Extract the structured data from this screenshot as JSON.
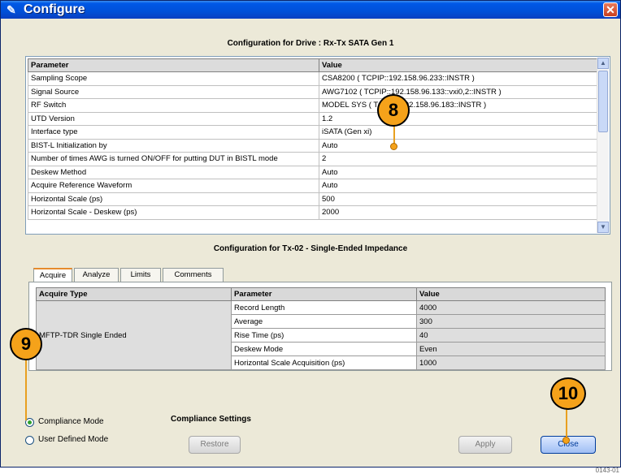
{
  "window": {
    "title": "Configure",
    "close_glyph": "✕",
    "icon": "wrench-icon"
  },
  "drive_section": {
    "title": "Configuration for Drive : Rx-Tx SATA Gen 1",
    "columns": [
      "Parameter",
      "Value"
    ],
    "rows": [
      [
        "Sampling Scope",
        "CSA8200 ( TCPIP::192.158.96.233::INSTR )"
      ],
      [
        "Signal Source",
        "AWG7102 ( TCPIP::192.158.96.133::vxi0,2::INSTR )"
      ],
      [
        "RF Switch",
        "MODEL SYS ( TCPIP::192.158.96.183::INSTR )"
      ],
      [
        "UTD Version",
        "1.2"
      ],
      [
        "Interface type",
        "iSATA (Gen xi)"
      ],
      [
        "BIST-L Initialization by",
        "Auto"
      ],
      [
        "Number of times AWG is turned ON/OFF for putting DUT in BISTL mode",
        "2"
      ],
      [
        "Deskew Method",
        "Auto"
      ],
      [
        "Acquire Reference Waveform",
        "Auto"
      ],
      [
        "Horizontal Scale (ps)",
        "500"
      ],
      [
        "Horizontal Scale - Deskew (ps)",
        "2000"
      ]
    ]
  },
  "test_section": {
    "title": "Configuration for Tx-02 - Single-Ended Impedance",
    "tabs": [
      "Acquire",
      "Analyze",
      "Limits",
      "Comments"
    ],
    "active_tab": "Acquire",
    "columns": [
      "Acquire Type",
      "Parameter",
      "Value"
    ],
    "acquire_type": "MFTP-TDR Single Ended",
    "rows": [
      [
        "Record Length",
        "4000"
      ],
      [
        "Average",
        "300"
      ],
      [
        "Rise Time (ps)",
        "40"
      ],
      [
        "Deskew Mode",
        "Even"
      ],
      [
        "Horizontal Scale Acquisition (ps)",
        "1000"
      ]
    ]
  },
  "modes": {
    "compliance": "Compliance Mode",
    "user_defined": "User Defined Mode",
    "selected": "compliance"
  },
  "compliance_settings": {
    "title": "Compliance Settings"
  },
  "buttons": {
    "restore": "Restore",
    "apply": "Apply",
    "close": "Close"
  },
  "callouts": {
    "c8": "8",
    "c9": "9",
    "c10": "10"
  },
  "colors": {
    "callout": "#f5a21a",
    "titlebar": "#0058e6",
    "close_button": "#c9401f"
  },
  "figure_code": "0143-01"
}
